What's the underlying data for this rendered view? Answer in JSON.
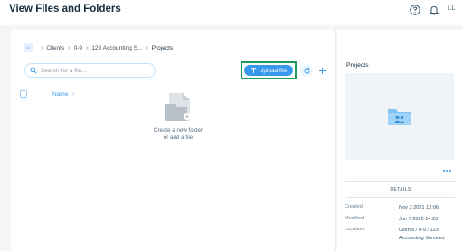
{
  "header": {
    "title": "View Files and Folders",
    "user_initials": "LL",
    "icons": [
      "help-icon",
      "bell-icon"
    ]
  },
  "breadcrumb": {
    "items": [
      "Clients",
      "0-9",
      "123 Accounting S...",
      "Projects"
    ]
  },
  "search": {
    "placeholder": "Search for a file..."
  },
  "toolbar": {
    "upload_label": "Upload file"
  },
  "list": {
    "column_name": "Name",
    "sort_indicator": "↑"
  },
  "empty_state": {
    "line1": "Create a new folder",
    "line2": "or add a file"
  },
  "side_panel": {
    "title": "Projects",
    "details_header": "DETAILS",
    "details": [
      {
        "label": "Created",
        "value": "Nov 3 2021 12:06"
      },
      {
        "label": "Modified",
        "value": "Jun 7 2022 14:23"
      },
      {
        "label": "Location",
        "value": "Clients / 0-9 / 123 Accounting Services"
      }
    ]
  },
  "colors": {
    "accent": "#3899ec",
    "highlight_border": "#1e9b5b",
    "title": "#162d3d"
  }
}
